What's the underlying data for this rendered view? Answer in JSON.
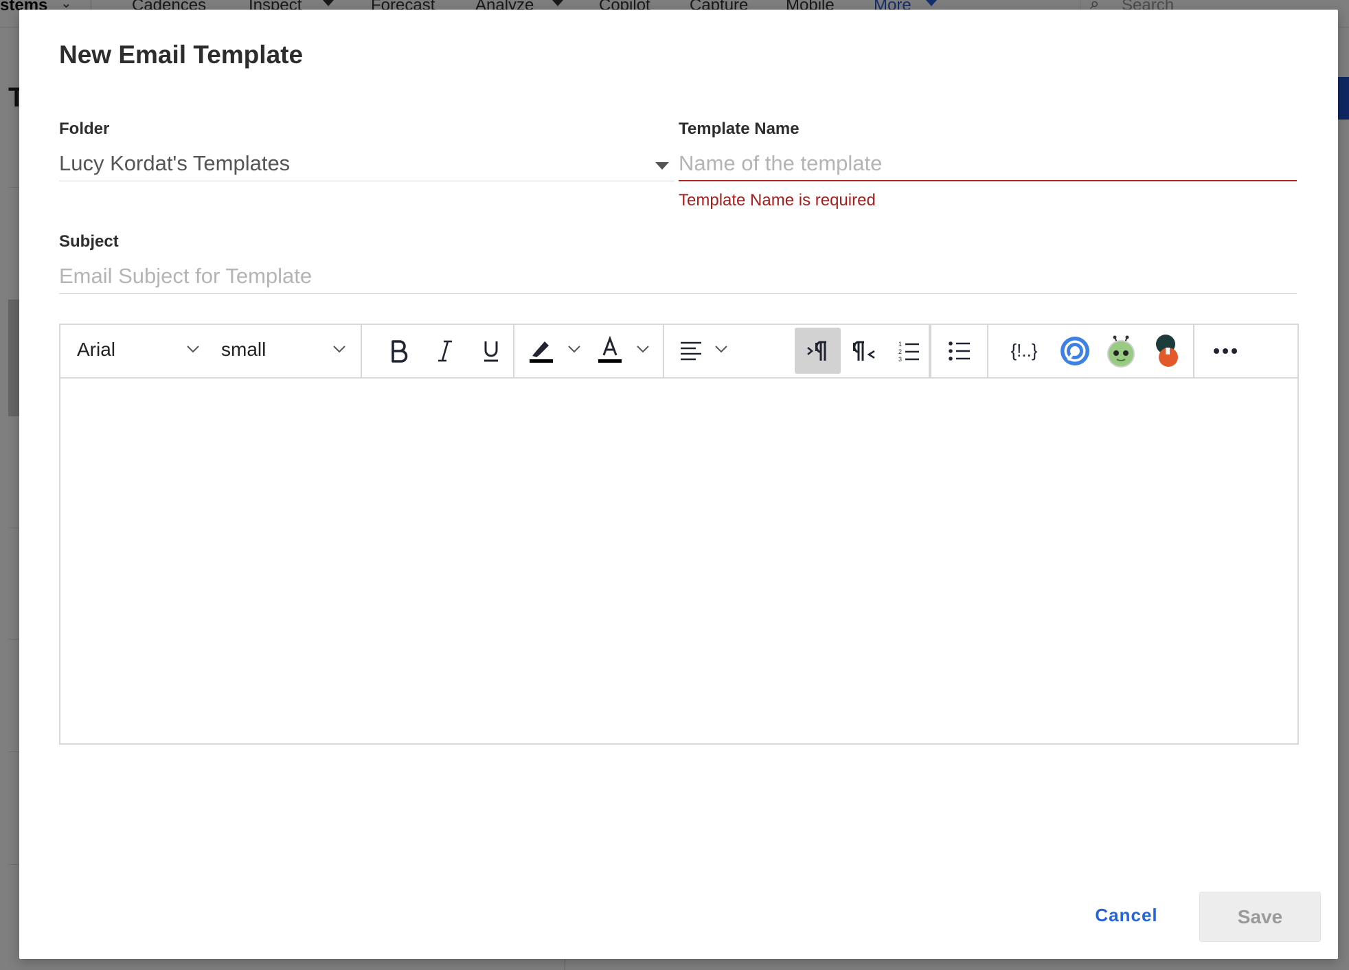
{
  "background": {
    "nav_items": [
      {
        "label": "stems",
        "name": "bg-nav-systems"
      },
      {
        "label": "Cadences",
        "name": "bg-nav-cadences"
      },
      {
        "label": "Inspect",
        "name": "bg-nav-inspect"
      },
      {
        "label": "Forecast",
        "name": "bg-nav-forecast"
      },
      {
        "label": "Analyze",
        "name": "bg-nav-analyze"
      },
      {
        "label": "Copilot",
        "name": "bg-nav-copilot"
      },
      {
        "label": "Capture",
        "name": "bg-nav-capture"
      },
      {
        "label": "Mobile",
        "name": "bg-nav-mobile"
      },
      {
        "label": "More",
        "name": "bg-nav-more"
      }
    ],
    "search_placeholder": "Search",
    "page_title_fragment": "T"
  },
  "modal": {
    "title": "New Email Template",
    "folder": {
      "label": "Folder",
      "value": "Lucy Kordat's Templates"
    },
    "template_name": {
      "label": "Template Name",
      "placeholder": "Name of the template",
      "value": "",
      "error": "Template Name is required"
    },
    "subject": {
      "label": "Subject",
      "placeholder": "Email Subject for Template",
      "value": ""
    },
    "toolbar": {
      "font_family": "Arial",
      "font_size": "small",
      "placeholder_token": "{!..}"
    },
    "footer": {
      "cancel_label": "Cancel",
      "save_label": "Save"
    }
  },
  "colors": {
    "error": "#b3211f",
    "link": "#2864d6",
    "save_disabled_bg": "#ededed",
    "overlay": "rgba(0,0,0,0.5)"
  }
}
